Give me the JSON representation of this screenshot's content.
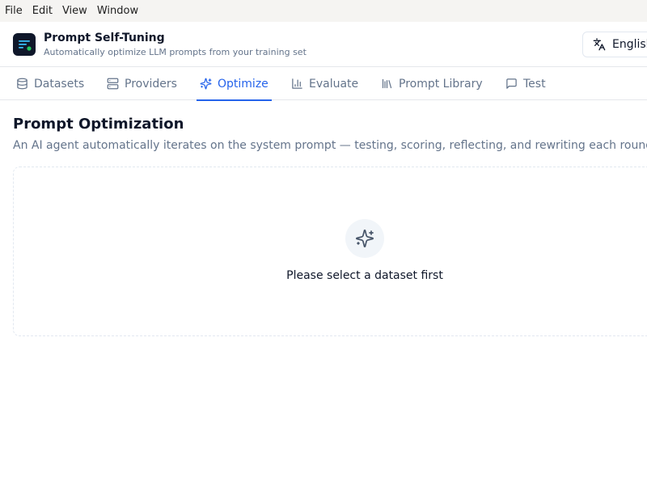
{
  "menubar": {
    "items": [
      "File",
      "Edit",
      "View",
      "Window"
    ]
  },
  "header": {
    "title": "Prompt Self-Tuning",
    "subtitle": "Automatically optimize LLM prompts from your training set",
    "language_label": "English",
    "language_icon": "translate-icon",
    "logo_icon": "app-logo-icon"
  },
  "tabs": [
    {
      "label": "Datasets",
      "icon": "database-icon",
      "active": false
    },
    {
      "label": "Providers",
      "icon": "server-icon",
      "active": false
    },
    {
      "label": "Optimize",
      "icon": "sparkles-icon",
      "active": true
    },
    {
      "label": "Evaluate",
      "icon": "bar-chart-icon",
      "active": false
    },
    {
      "label": "Prompt Library",
      "icon": "library-icon",
      "active": false
    },
    {
      "label": "Test",
      "icon": "message-icon",
      "active": false
    }
  ],
  "main": {
    "title": "Prompt Optimization",
    "description": "An AI agent automatically iterates on the system prompt — testing, scoring, reflecting, and rewriting each round",
    "empty_state": {
      "icon": "sparkles-icon",
      "message": "Please select a dataset first"
    }
  },
  "colors": {
    "accent": "#2563eb",
    "muted_text": "#64748b",
    "logo_bg": "#0f172a",
    "logo_dot": "#22c55e"
  }
}
